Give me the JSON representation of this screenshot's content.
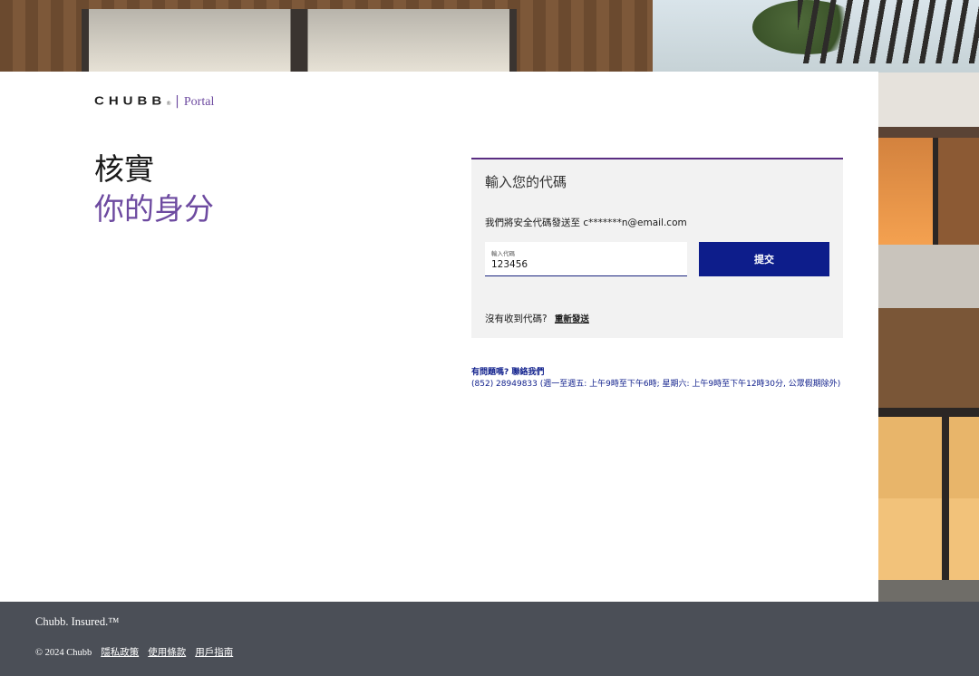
{
  "brand": {
    "logo_text": "CHUBB",
    "registered_mark": "®",
    "separator": "|",
    "portal_label": "Portal"
  },
  "headline": {
    "line1": "核實",
    "line2": "你的身分"
  },
  "verification": {
    "title": "輸入您的代碼",
    "info": "我們將安全代碼發送至 c*******n@email.com",
    "code_label": "輸入代碼",
    "code_value": "123456",
    "submit_label": "提交",
    "no_code_text": "沒有收到代碼?",
    "resend_label": "重新發送"
  },
  "help": {
    "title": "有問題嗎? 聯絡我們",
    "details": "(852) 28949833 (週一至週五: 上午9時至下午6時; 星期六: 上午9時至下午12時30分, 公眾假期除外)"
  },
  "footer": {
    "tagline": "Chubb. Insured.™",
    "copyright": "© 2024 Chubb",
    "links": [
      "隱私政策",
      "使用條款",
      "用戶指南"
    ]
  },
  "colors": {
    "accent_purple": "#6d4aa0",
    "primary_navy": "#0d1d8b",
    "footer_bg": "#4b4f57",
    "card_bg": "#f2f2f2"
  }
}
